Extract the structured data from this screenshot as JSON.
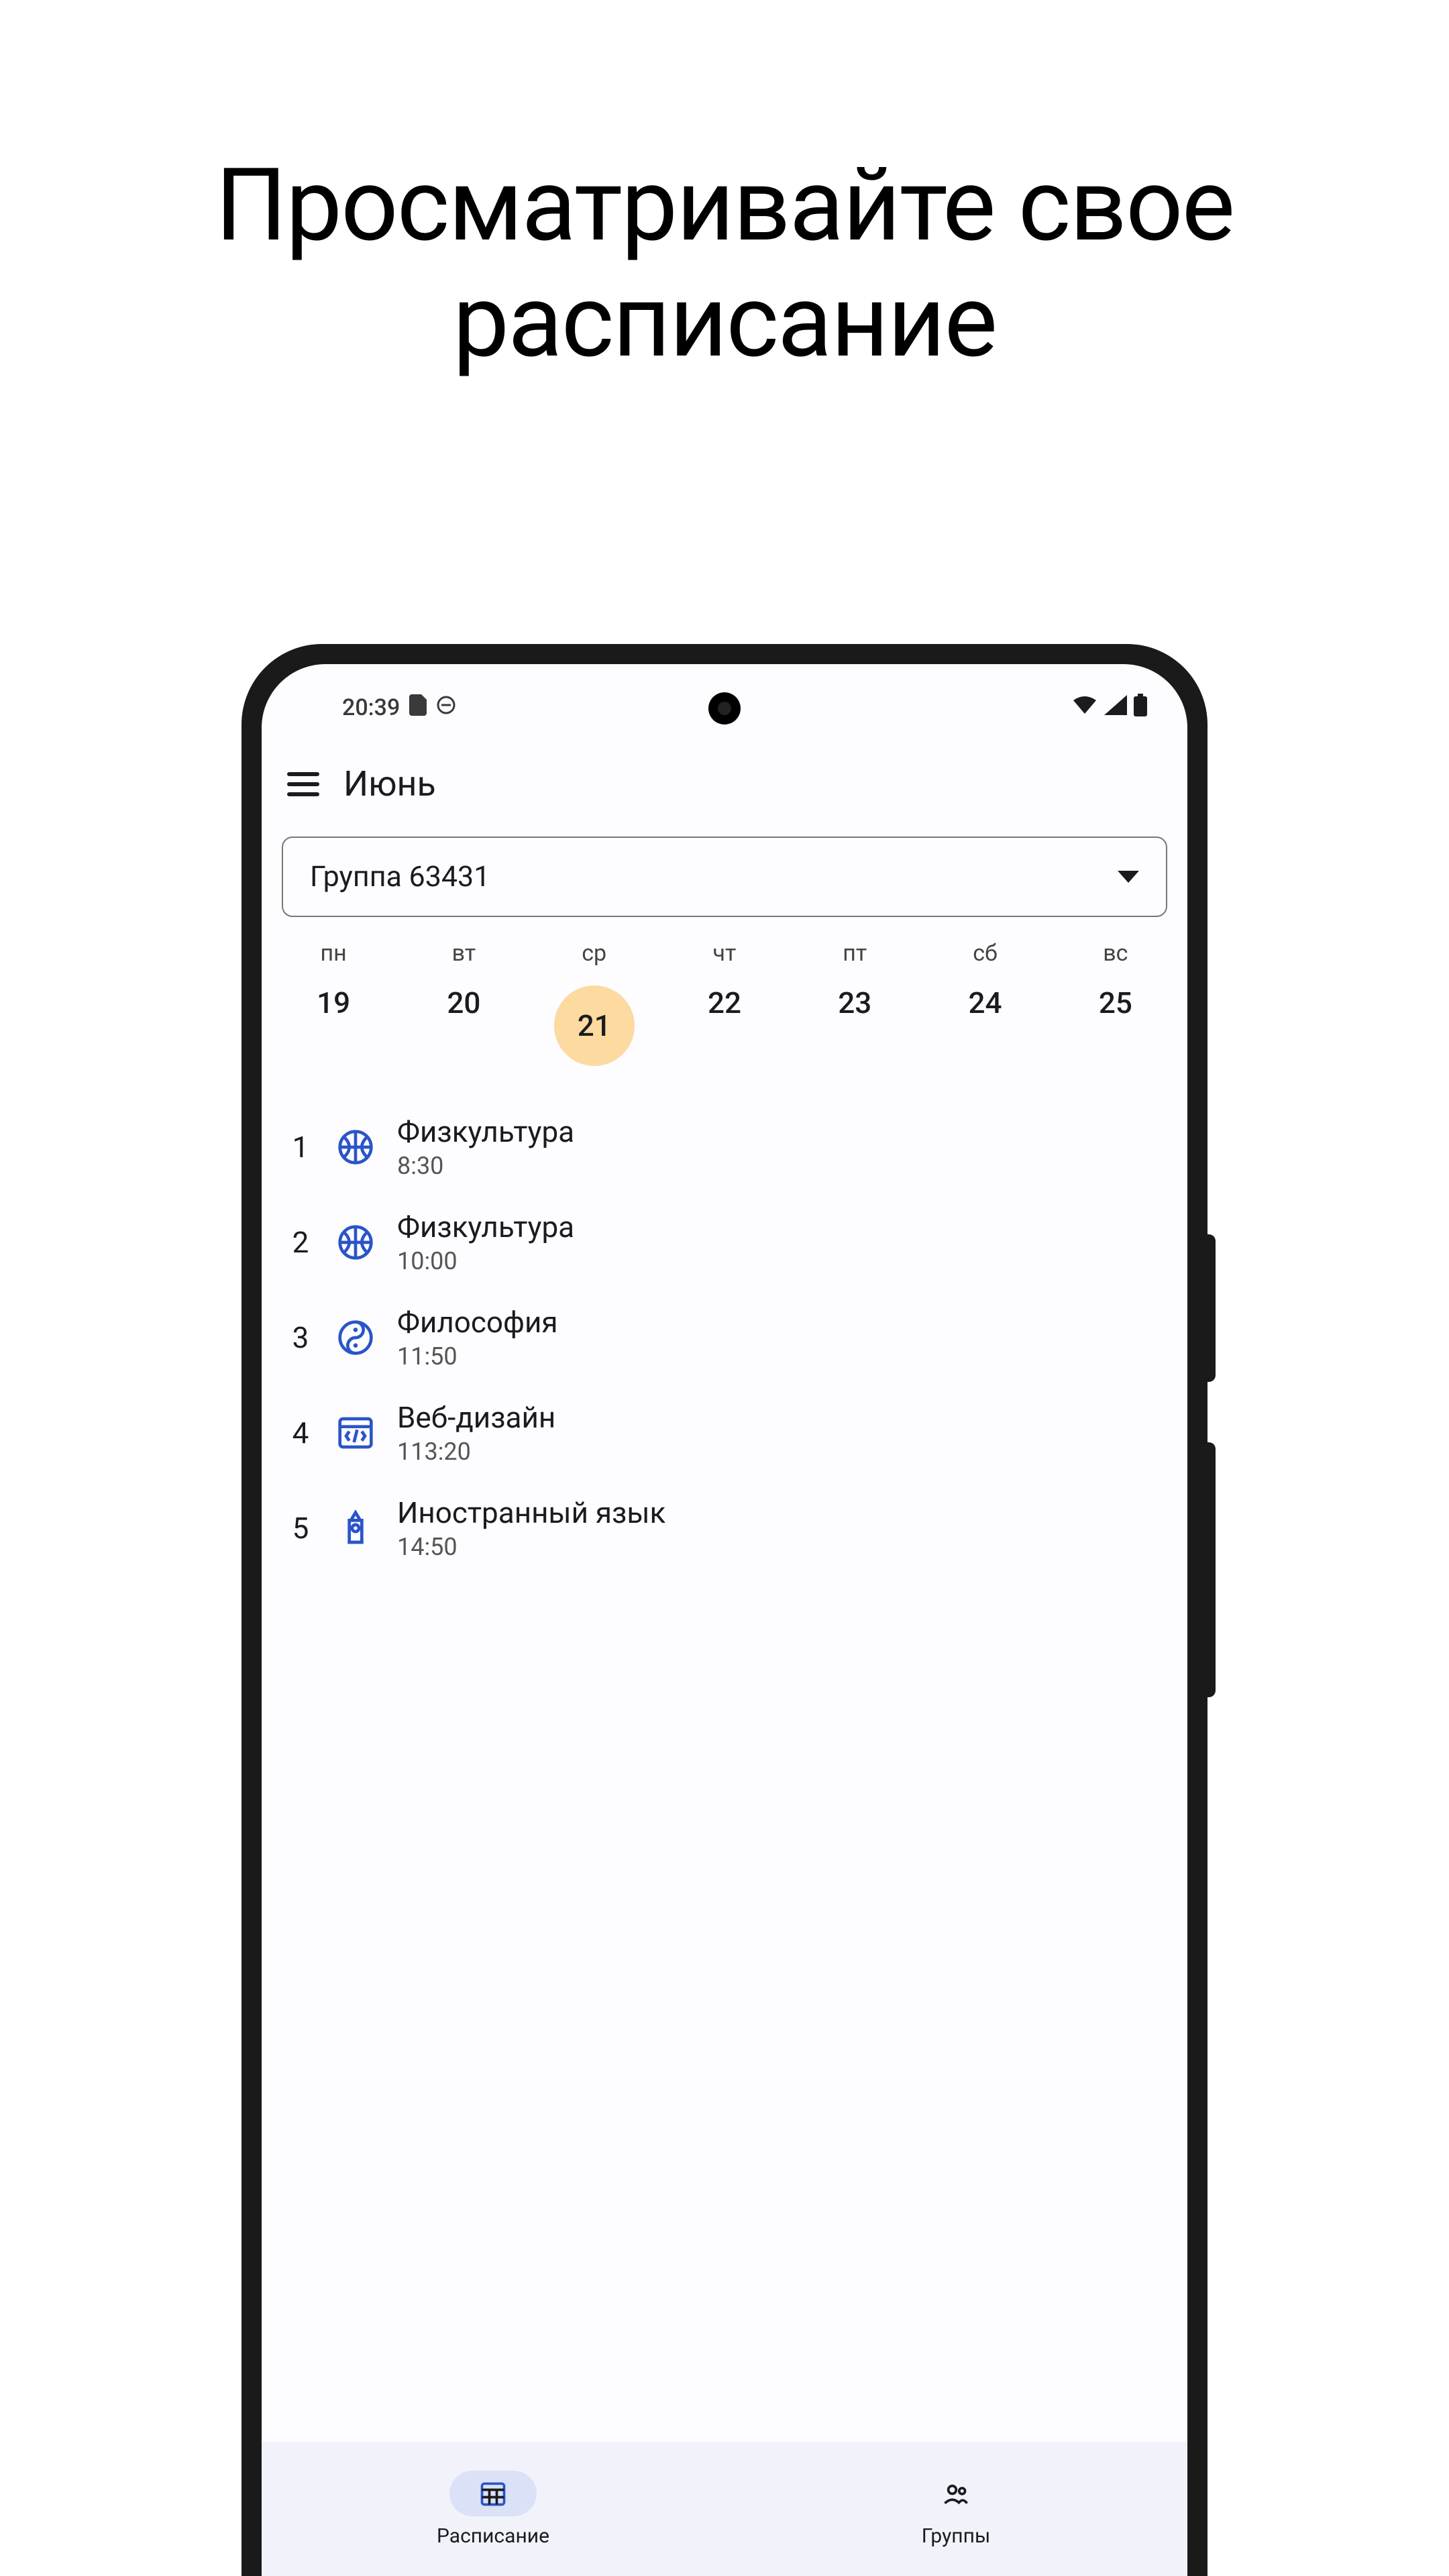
{
  "headline": "Просматривайте свое\nрасписание",
  "status": {
    "time": "20:39"
  },
  "app": {
    "title": "Июнь",
    "group_selector": "Группа 63431",
    "days": [
      {
        "dow": "пн",
        "num": "19",
        "selected": false
      },
      {
        "dow": "вт",
        "num": "20",
        "selected": false
      },
      {
        "dow": "ср",
        "num": "21",
        "selected": true
      },
      {
        "dow": "чт",
        "num": "22",
        "selected": false
      },
      {
        "dow": "пт",
        "num": "23",
        "selected": false
      },
      {
        "dow": "сб",
        "num": "24",
        "selected": false
      },
      {
        "dow": "вс",
        "num": "25",
        "selected": false
      }
    ],
    "lessons": [
      {
        "n": "1",
        "title": "Физкультура",
        "time": "8:30",
        "icon": "basketball"
      },
      {
        "n": "2",
        "title": "Физкультура",
        "time": "10:00",
        "icon": "basketball"
      },
      {
        "n": "3",
        "title": "Философия",
        "time": "11:50",
        "icon": "yinyang"
      },
      {
        "n": "4",
        "title": "Веб-дизайн",
        "time": "113:20",
        "icon": "webwindow"
      },
      {
        "n": "5",
        "title": "Иностранный язык",
        "time": "14:50",
        "icon": "bigben"
      }
    ],
    "nav": [
      {
        "label": "Расписание",
        "icon": "schedule",
        "active": true
      },
      {
        "label": "Группы",
        "icon": "groups",
        "active": false
      }
    ]
  }
}
